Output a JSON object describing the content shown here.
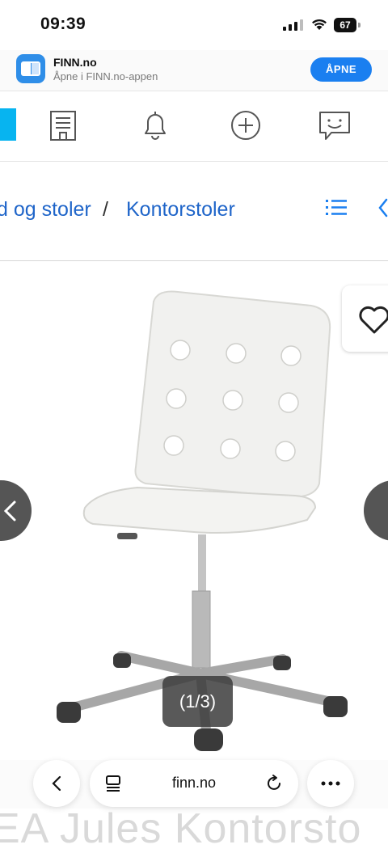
{
  "status_bar": {
    "time": "09:39",
    "battery": "67"
  },
  "app_banner": {
    "name": "FINN.no",
    "subtitle": "Åpne i FINN.no-appen",
    "open_label": "ÅPNE"
  },
  "breadcrumb": {
    "parent": "d og stoler",
    "separator": "/",
    "current": "Kontorstoler"
  },
  "gallery": {
    "counter": "(1/3)"
  },
  "product": {
    "title": "EA Jules Kontorsto"
  },
  "browser": {
    "url": "finn.no"
  },
  "colors": {
    "accent": "#1a7ff0",
    "link": "#1f65c9",
    "finn_blue": "#07b4f0"
  },
  "icons": [
    "signal-icon",
    "wifi-icon",
    "battery-icon",
    "finn-app-icon",
    "building-icon",
    "bell-icon",
    "plus-circle-icon",
    "chat-icon",
    "list-icon",
    "chevron-left-icon",
    "heart-icon",
    "tabs-icon",
    "reload-icon",
    "more-icon"
  ]
}
